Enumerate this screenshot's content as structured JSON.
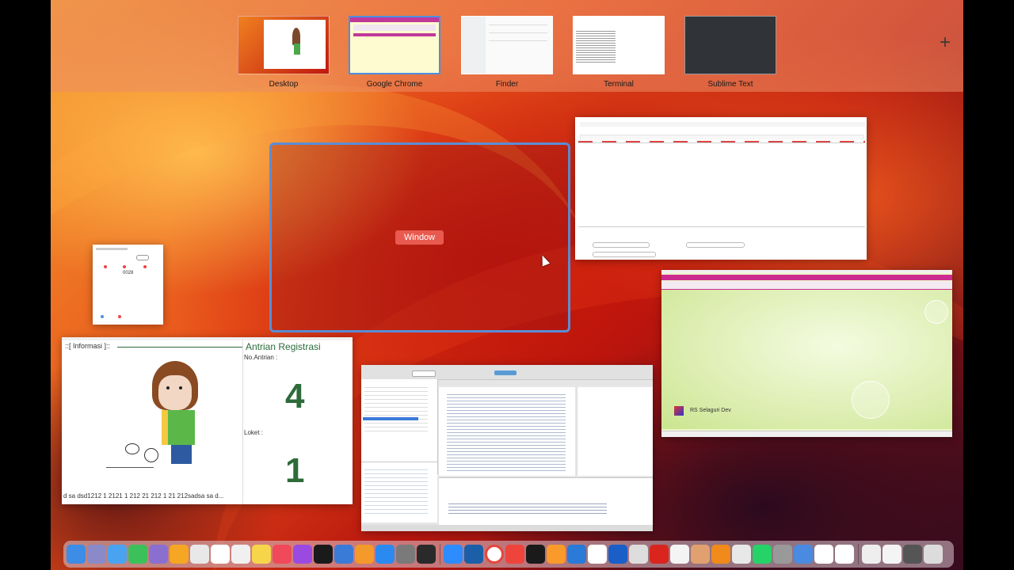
{
  "spaces": [
    {
      "label": "Desktop"
    },
    {
      "label": "Google Chrome"
    },
    {
      "label": "Finder"
    },
    {
      "label": "Terminal"
    },
    {
      "label": "Sublime Text"
    }
  ],
  "add_space_symbol": "+",
  "hovered_window_label": "Window",
  "antrian": {
    "info_title": "::[ Informasi ]::",
    "title": "Antrian Registrasi",
    "no_antrian_label": "No.Antrian :",
    "no_antrian_value": "4",
    "loket_label": "Loket :",
    "loket_value": "1",
    "marquee": "d sa dsd1212 1 2121 1 212 21 212 1 21 212sadsa sa d..."
  },
  "small_dialog": {
    "number": "0028"
  },
  "pink_app": {
    "brand": "RS Selaguri Dev"
  },
  "dock_icons": [
    "finder-icon",
    "launchpad-icon",
    "mail-icon",
    "facetime-icon",
    "app-icon",
    "photos-icon",
    "safari-icon",
    "calendar-icon",
    "reminders-icon",
    "notes-icon",
    "music-icon",
    "podcasts-icon",
    "tv-icon",
    "keynote-icon",
    "pages-icon",
    "appstore-icon",
    "settings-icon",
    "terminal-icon",
    "zoom-icon",
    "virtualbox-icon",
    "chrome-icon",
    "anydesk-icon",
    "app2-icon",
    "sublime-icon",
    "vscode-icon",
    "word-icon",
    "outlook-icon",
    "app3-icon",
    "acrobat-icon",
    "sketch-icon",
    "app4-icon",
    "vlc-icon",
    "app5-icon",
    "whatsapp-icon",
    "printer-icon",
    "app6-icon",
    "app7-icon",
    "app8-icon",
    "doc-icon",
    "doc2-icon",
    "archive-icon",
    "trash-icon"
  ]
}
